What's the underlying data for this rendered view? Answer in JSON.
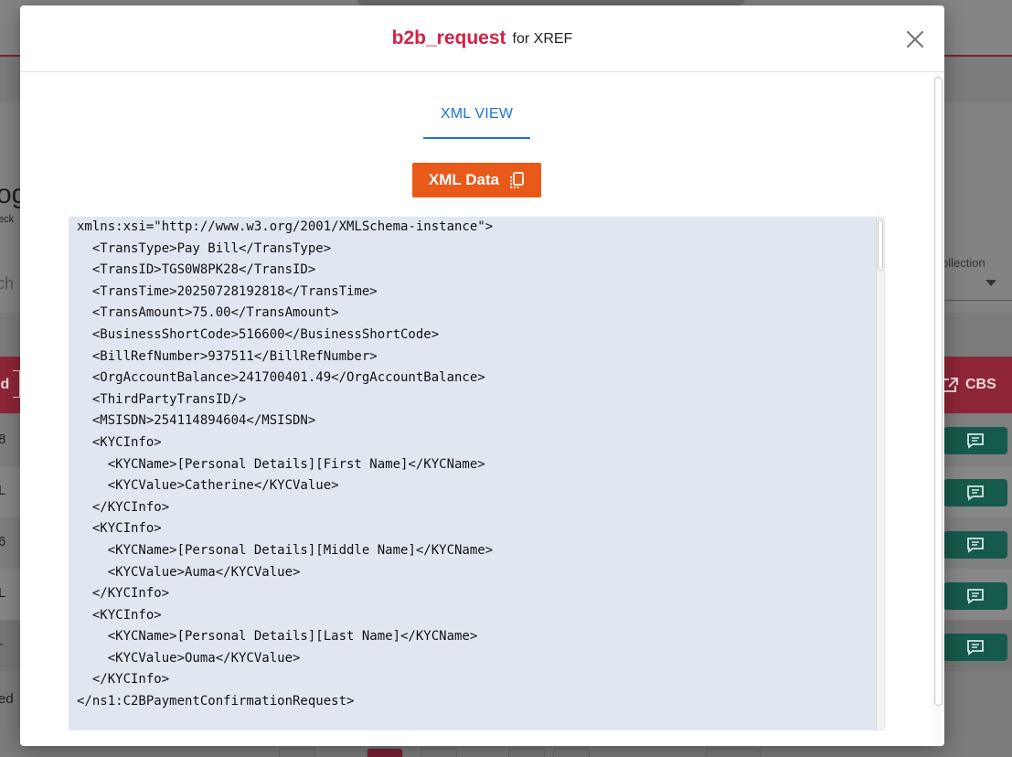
{
  "background": {
    "title_fragment": "og",
    "subtitle_fragment": "eck",
    "search_fragment": "ch",
    "collection_label": "ollection",
    "table_header_left": "ld",
    "table_header_right": "CBS",
    "rows": [
      "8",
      "L",
      "6",
      "L",
      "-"
    ],
    "footer_fragment": "ed"
  },
  "modal": {
    "title": "b2b_request",
    "subtitle": "for XREF",
    "tab_label": "XML VIEW",
    "copy_button_label": "XML Data",
    "xml_lines": [
      "xmlns:xsi=\"http://www.w3.org/2001/XMLSchema-instance\">",
      "  <TransType>Pay Bill</TransType>",
      "  <TransID>TGS0W8PK28</TransID>",
      "  <TransTime>20250728192818</TransTime>",
      "  <TransAmount>75.00</TransAmount>",
      "  <BusinessShortCode>516600</BusinessShortCode>",
      "  <BillRefNumber>937511</BillRefNumber>",
      "  <OrgAccountBalance>241700401.49</OrgAccountBalance>",
      "  <ThirdPartyTransID/>",
      "  <MSISDN>254114894604</MSISDN>",
      "  <KYCInfo>",
      "    <KYCName>[Personal Details][First Name]</KYCName>",
      "    <KYCValue>Catherine</KYCValue>",
      "  </KYCInfo>",
      "  <KYCInfo>",
      "    <KYCName>[Personal Details][Middle Name]</KYCName>",
      "    <KYCValue>Auma</KYCValue>",
      "  </KYCInfo>",
      "  <KYCInfo>",
      "    <KYCName>[Personal Details][Last Name]</KYCName>",
      "    <KYCValue>Ouma</KYCValue>",
      "  </KYCInfo>",
      "</ns1:C2BPaymentConfirmationRequest>"
    ]
  },
  "icons": {
    "close": "close-icon",
    "copy": "copy-icon",
    "chat": "chat-icon",
    "external": "open-external-icon"
  },
  "colors": {
    "title_accent": "#d42145",
    "tab_accent": "#1976d2",
    "copy_button": "#e8591a",
    "code_background": "#e1e7f0",
    "table_header": "#8f2637",
    "chat_button": "#165a4d"
  }
}
